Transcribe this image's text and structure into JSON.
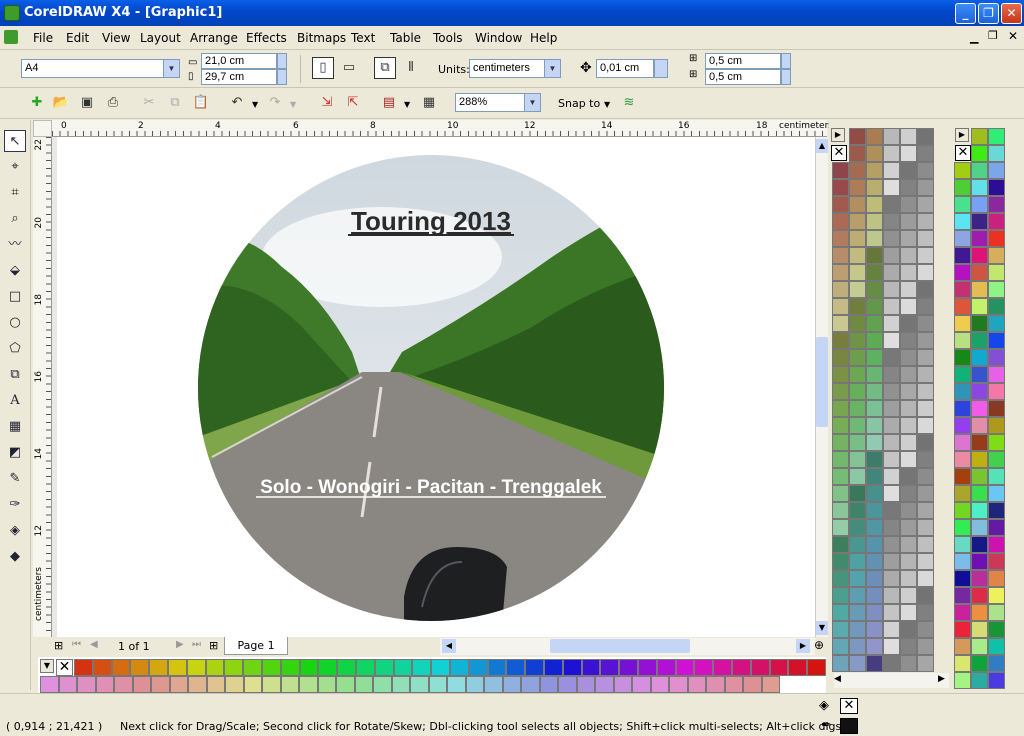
{
  "window": {
    "title": "CorelDRAW X4 - [Graphic1]"
  },
  "menu": [
    "File",
    "Edit",
    "View",
    "Layout",
    "Arrange",
    "Effects",
    "Bitmaps",
    "Text",
    "Table",
    "Tools",
    "Window",
    "Help"
  ],
  "property_bar": {
    "paper_size": "A4",
    "width": "21,0 cm",
    "height": "29,7 cm",
    "units_label": "Units:",
    "units_value": "centimeters",
    "nudge": "0,01 cm",
    "dup_x": "0,5 cm",
    "dup_y": "0,5 cm"
  },
  "standard_bar": {
    "zoom": "288%",
    "snap_to": "Snap to"
  },
  "ruler": {
    "unit_label": "centimeters",
    "h_ticks": [
      "0",
      "2",
      "4",
      "6",
      "8",
      "10",
      "12",
      "14",
      "16",
      "18"
    ],
    "v_ticks": [
      "22",
      "20",
      "18",
      "16",
      "14",
      "12"
    ],
    "v_unit": "centimeters"
  },
  "artwork": {
    "title": "Touring 2013",
    "route": "Solo - Wonogiri - Pacitan - Trenggalek"
  },
  "page_nav": {
    "count": "1 of 1",
    "tab": "Page 1"
  },
  "status": {
    "coords": "( 0,914 ; 21,421 )",
    "hint": "Next click for Drag/Scale; Second click for Rotate/Skew; Dbl-clicking tool selects all objects; Shift+click multi-selects; Alt+click digs"
  },
  "colors": {
    "titlebar": "#0346c9",
    "sky": "#dfe6ec",
    "foliage": "#3f7a2a",
    "road": "#8a8782"
  }
}
